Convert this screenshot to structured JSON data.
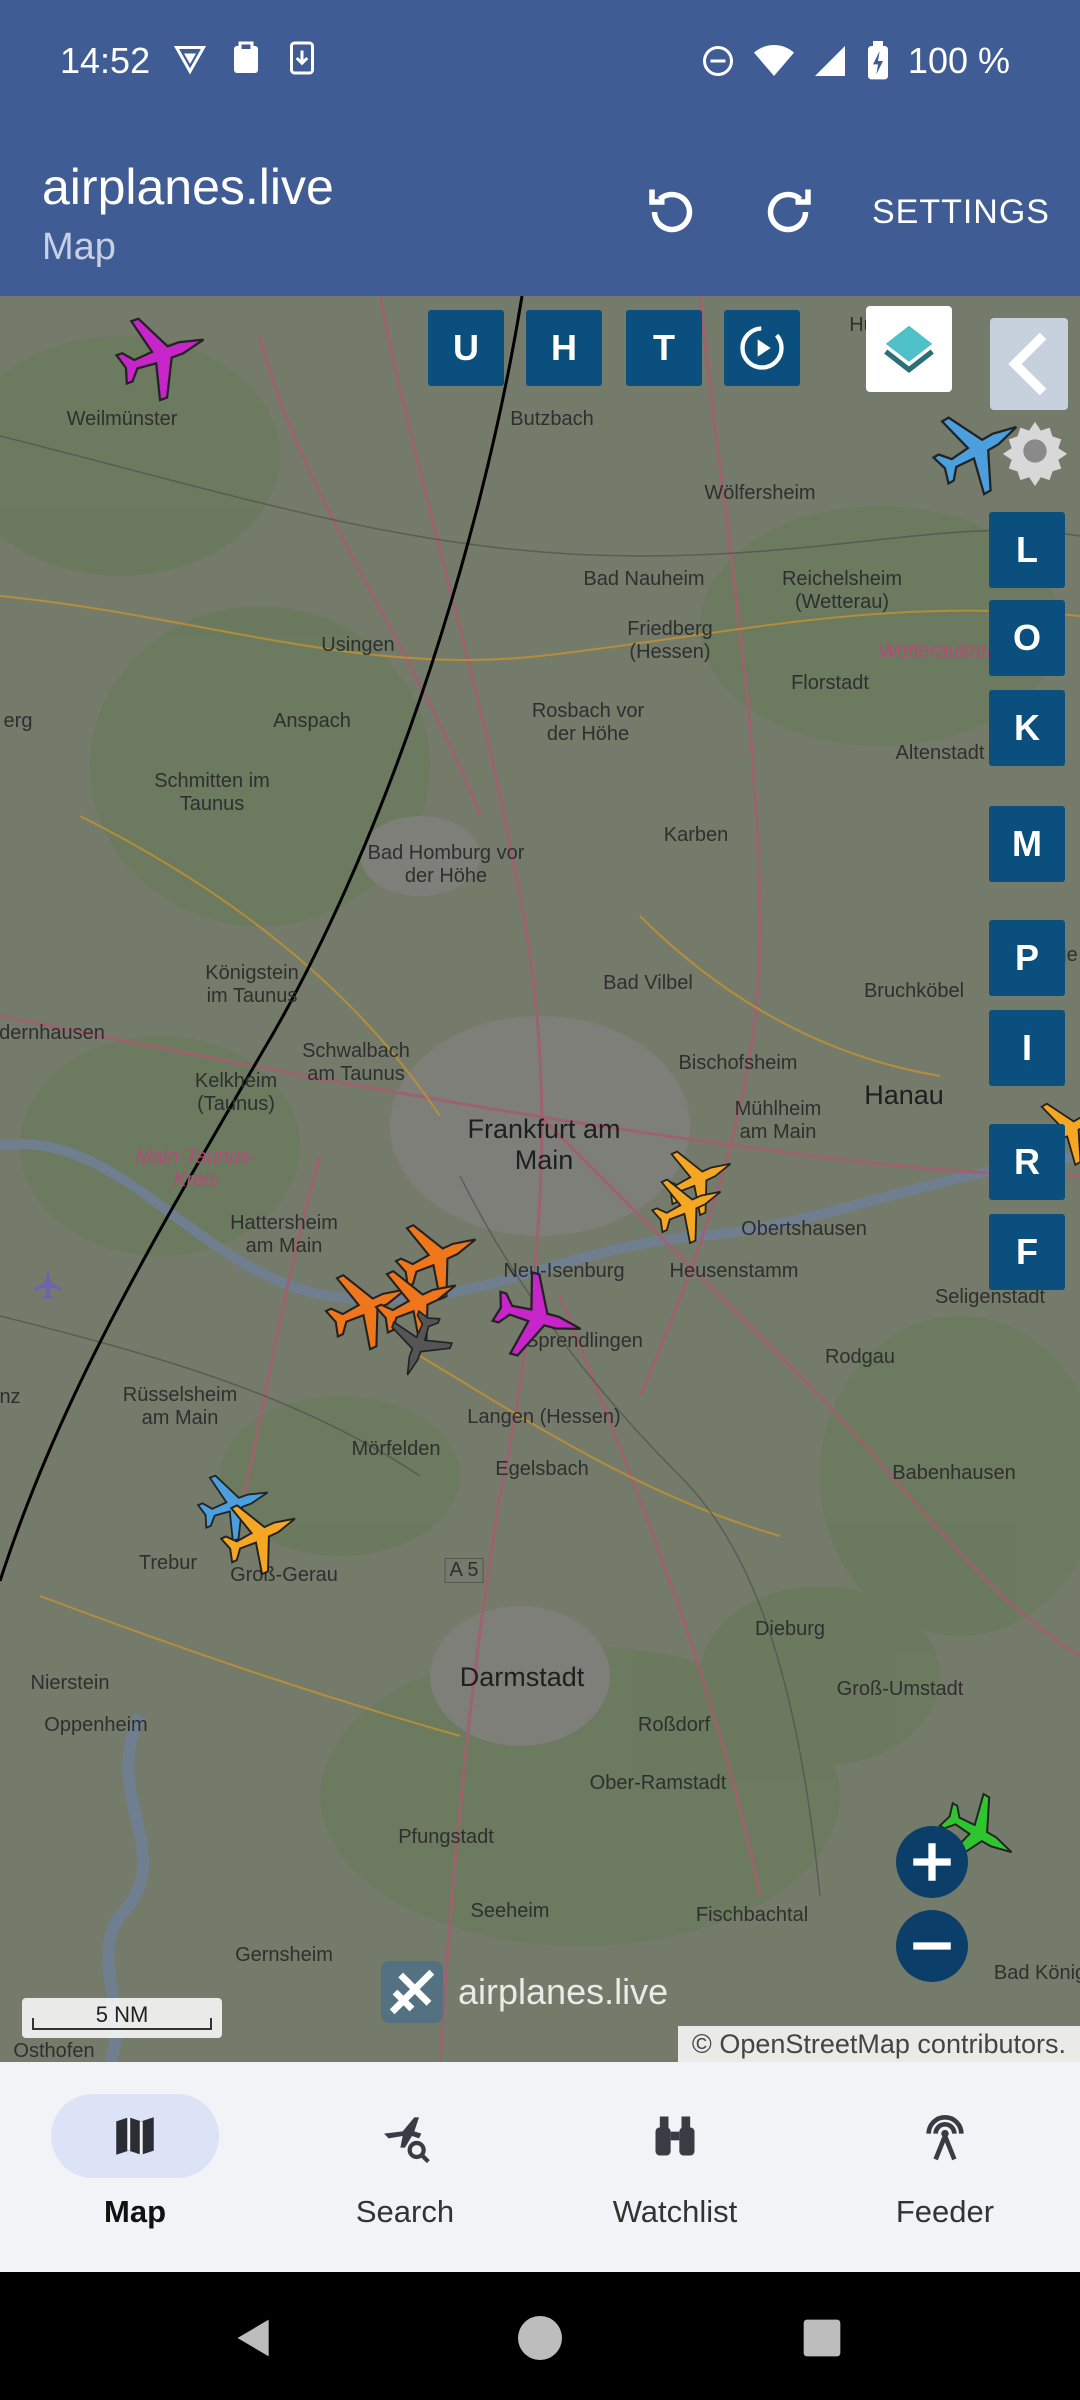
{
  "status_bar": {
    "time": "14:52",
    "battery": "100 %"
  },
  "app_bar": {
    "title": "airplanes.live",
    "subtitle": "Map",
    "settings_label": "SETTINGS"
  },
  "map_controls": {
    "top_buttons": [
      "U",
      "H",
      "T"
    ],
    "side_buttons": [
      "L",
      "O",
      "K",
      "M",
      "P",
      "I",
      "R",
      "F"
    ]
  },
  "map_labels": [
    "Weilmünster",
    "Butzbach",
    "Wölfersheim",
    "Bad Nauheim",
    "Reichelsheim (Wetterau)",
    "Friedberg (Hessen)",
    "Florstadt",
    "Wetteraukreis",
    "Usingen",
    "Anspach",
    "Rosbach vor der Höhe",
    "Altenstadt",
    "Schmitten im Taunus",
    "Bad Homburg vor der Höhe",
    "Karben",
    "Königstein im Taunus",
    "Bad Vilbel",
    "Bruchköbel",
    "Schwalbach am Taunus",
    "Kelkheim (Taunus)",
    "Bischofsheim",
    "Mühlheim am Main",
    "Hanau",
    "Frankfurt am Main",
    "Main-Taunus-Kreis",
    "Hattersheim am Main",
    "Obertshausen",
    "Neu-Isenburg",
    "Heusenstamm",
    "Seligenstadt",
    "Sprendlingen",
    "Rodgau",
    "Rüsselsheim am Main",
    "Langen (Hessen)",
    "Mörfelden",
    "Egelsbach",
    "Babenhausen",
    "Trebur",
    "Groß-Gerau",
    "A 5",
    "Dieburg",
    "Nierstein",
    "Darmstadt",
    "Groß-Umstadt",
    "Oppenheim",
    "Roßdorf",
    "Ober-Ramstadt",
    "Pfungstadt",
    "Seeheim",
    "Fischbachtal",
    "Gernsheim",
    "Osthofen",
    "Bad König",
    "erg",
    "dernhausen",
    "nz",
    "Hu",
    "Lange"
  ],
  "scale": "5 NM",
  "watermark": "airplanes.live",
  "attribution": "© OpenStreetMap contributors.",
  "bottom_nav": [
    {
      "label": "Map",
      "active": true
    },
    {
      "label": "Search",
      "active": false
    },
    {
      "label": "Watchlist",
      "active": false
    },
    {
      "label": "Feeder",
      "active": false
    }
  ],
  "colors": {
    "app_bar": "#3f5c94",
    "map_button": "#0b4f7e",
    "nav_background": "#f2f3f7",
    "nav_active_pill": "#dde3f6",
    "aircraft": [
      "#c724c9",
      "#f0761c",
      "#f5a623",
      "#4a9fdc",
      "#2ec62e",
      "#555555"
    ]
  }
}
